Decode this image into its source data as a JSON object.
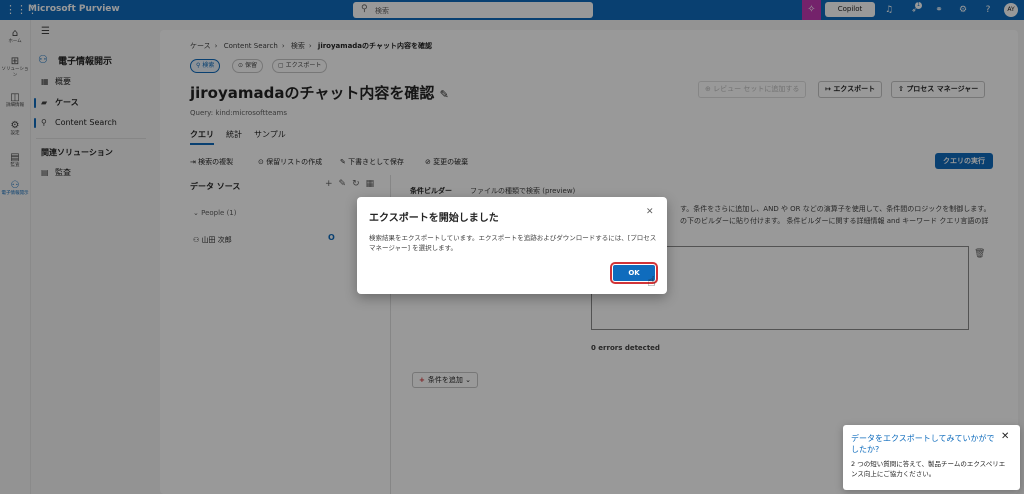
{
  "topbar": {
    "app_name": "Microsoft Purview",
    "search_placeholder": "検索",
    "copilot_label": "Copilot",
    "notification_count": "1",
    "avatar_initials": "AY"
  },
  "rail": {
    "items": [
      {
        "label": "ホーム",
        "icon": "home-icon"
      },
      {
        "label": "ソリューション",
        "icon": "solutions-icon"
      },
      {
        "label": "詳細情報",
        "icon": "learn-icon"
      },
      {
        "label": "設定",
        "icon": "settings-icon"
      },
      {
        "label": "監査",
        "icon": "audit-icon"
      },
      {
        "label": "電子情報開示",
        "icon": "ediscovery-icon"
      }
    ]
  },
  "nav": {
    "title": "電子情報開示",
    "items": [
      {
        "label": "概要"
      },
      {
        "label": "ケース"
      },
      {
        "label": "Content Search"
      }
    ],
    "section_title": "関連ソリューション",
    "section_items": [
      {
        "label": "監査"
      }
    ]
  },
  "main": {
    "breadcrumb": [
      "ケース",
      "Content Search",
      "検索",
      "jiroyamadaのチャット内容を確認"
    ],
    "pills": [
      "検索",
      "保留",
      "エクスポート"
    ],
    "title": "jiroyamadaのチャット内容を確認",
    "query": "Query: kind:microsoftteams",
    "tabs": [
      "クエリ",
      "統計",
      "サンプル"
    ],
    "header_buttons": {
      "add_review": "レビュー セットに追加する",
      "export": "エクスポート",
      "process_manager": "プロセス マネージャー"
    },
    "toolbar": [
      "検索の複製",
      "保留リストの作成",
      "下書きとして保存",
      "変更の破棄"
    ],
    "run_query": "クエリの実行",
    "data_source_title": "データ ソース",
    "people_group": "People (1)",
    "person_name": "山田 次郎",
    "condition_builder": "条件ビルダー",
    "condition_sub": "ファイルの種類で検索 (preview)",
    "desc_line1": "す。条件をさらに追加し、AND や OR などの演算子を使用して、条件間のロジックを制御します。",
    "desc_line2": "の下のビルダーに貼り付けます。 条件ビルダーに関する詳細情報 and キーワード クエリ言語の詳",
    "errors": "0 errors detected",
    "add_condition": "条件を追加"
  },
  "dialog": {
    "title": "エクスポートを開始しました",
    "body": "検索結果をエクスポートしています。エクスポートを追跡およびダウンロードするには、[プロセス マネージャー] を選択します。",
    "ok": "OK"
  },
  "survey": {
    "title": "データをエクスポートしてみていかがでしたか?",
    "body": "2 つの短い質問に答えて、製品チームのエクスペリエンス向上にご協力ください。"
  }
}
